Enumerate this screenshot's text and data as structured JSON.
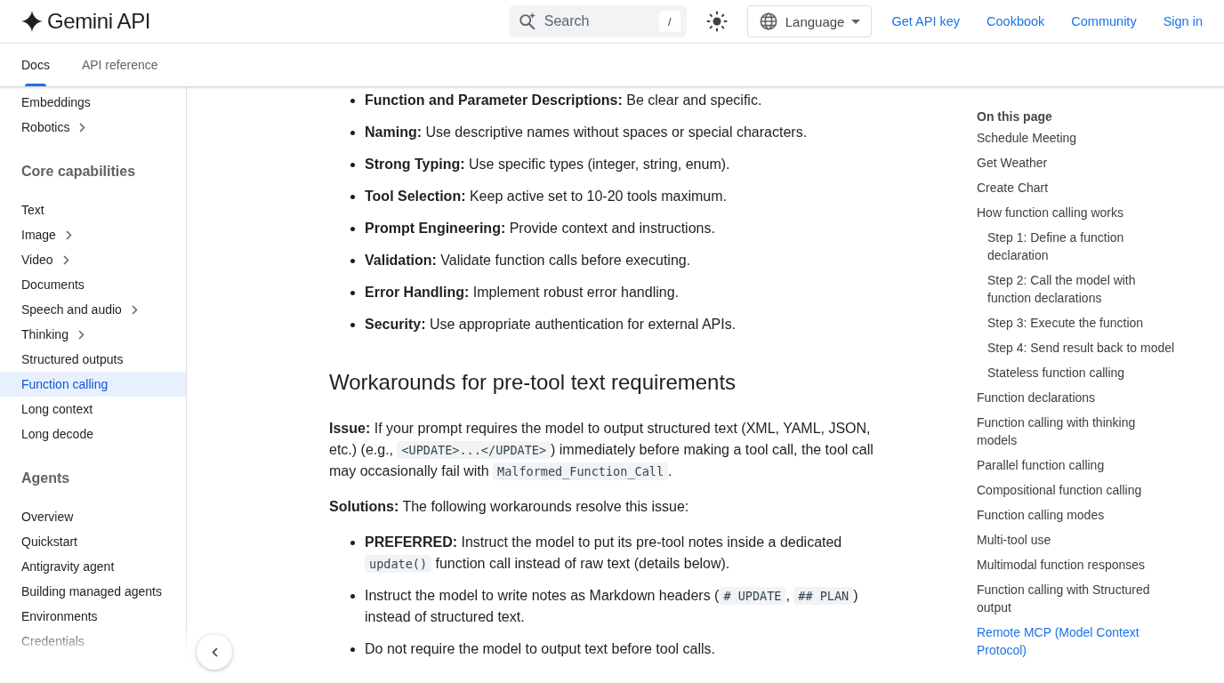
{
  "header": {
    "product_name": "Gemini API",
    "search": {
      "placeholder": "Search",
      "shortcut": "/"
    },
    "language_button": {
      "label": "Language"
    },
    "links": [
      "Get API key",
      "Cookbook",
      "Community",
      "Sign in"
    ]
  },
  "tabs": [
    {
      "label": "Docs",
      "selected": true
    },
    {
      "label": "API reference",
      "selected": false
    }
  ],
  "sidebar": {
    "groups": [
      {
        "items": [
          {
            "label": "Embeddings",
            "selected": false,
            "expandable": false
          },
          {
            "label": "Robotics",
            "selected": false,
            "expandable": true
          }
        ]
      },
      {
        "heading": "Core capabilities",
        "items": [
          {
            "label": "Text",
            "selected": false,
            "expandable": false
          },
          {
            "label": "Image",
            "selected": false,
            "expandable": true
          },
          {
            "label": "Video",
            "selected": false,
            "expandable": true
          },
          {
            "label": "Documents",
            "selected": false,
            "expandable": false
          },
          {
            "label": "Speech and audio",
            "selected": false,
            "expandable": true
          },
          {
            "label": "Thinking",
            "selected": false,
            "expandable": true
          },
          {
            "label": "Structured outputs",
            "selected": false,
            "expandable": false
          },
          {
            "label": "Function calling",
            "selected": true,
            "expandable": false
          },
          {
            "label": "Long context",
            "selected": false,
            "expandable": false
          },
          {
            "label": "Long decode",
            "selected": false,
            "expandable": false
          }
        ]
      },
      {
        "heading": "Agents",
        "items": [
          {
            "label": "Overview",
            "selected": false,
            "expandable": false
          },
          {
            "label": "Quickstart",
            "selected": false,
            "expandable": false
          },
          {
            "label": "Antigravity agent",
            "selected": false,
            "expandable": false
          },
          {
            "label": "Building managed agents",
            "selected": false,
            "expandable": false
          },
          {
            "label": "Environments",
            "selected": false,
            "expandable": false
          },
          {
            "label": "Credentials",
            "selected": false,
            "expandable": false
          }
        ]
      }
    ]
  },
  "article": {
    "blocks": [
      {
        "kind": "list",
        "items": [
          {
            "segments": [
              {
                "kind": "bold",
                "text": "Function and Parameter Descriptions:"
              },
              {
                "kind": "text",
                "text": " Be clear and specific."
              }
            ]
          },
          {
            "segments": [
              {
                "kind": "bold",
                "text": "Naming:"
              },
              {
                "kind": "text",
                "text": " Use descriptive names without spaces or special characters."
              }
            ]
          },
          {
            "segments": [
              {
                "kind": "bold",
                "text": "Strong Typing:"
              },
              {
                "kind": "text",
                "text": " Use specific types (integer, string, enum)."
              }
            ]
          },
          {
            "segments": [
              {
                "kind": "bold",
                "text": "Tool Selection:"
              },
              {
                "kind": "text",
                "text": " Keep active set to 10-20 tools maximum."
              }
            ]
          },
          {
            "segments": [
              {
                "kind": "bold",
                "text": "Prompt Engineering:"
              },
              {
                "kind": "text",
                "text": " Provide context and instructions."
              }
            ]
          },
          {
            "segments": [
              {
                "kind": "bold",
                "text": "Validation:"
              },
              {
                "kind": "text",
                "text": " Validate function calls before executing."
              }
            ]
          },
          {
            "segments": [
              {
                "kind": "bold",
                "text": "Error Handling:"
              },
              {
                "kind": "text",
                "text": " Implement robust error handling."
              }
            ]
          },
          {
            "segments": [
              {
                "kind": "bold",
                "text": "Security:"
              },
              {
                "kind": "text",
                "text": " Use appropriate authentication for external APIs."
              }
            ]
          }
        ]
      },
      {
        "kind": "heading",
        "text": "Workarounds for pre-tool text requirements"
      },
      {
        "kind": "paragraph",
        "segments": [
          {
            "kind": "bold",
            "text": "Issue:"
          },
          {
            "kind": "text",
            "text": " If your prompt requires the model to output structured text (XML, YAML, JSON, etc.) (e.g., "
          },
          {
            "kind": "code",
            "text": "<UPDATE>...</UPDATE>"
          },
          {
            "kind": "text",
            "text": ") immediately before making a tool call, the tool call may occasionally fail with "
          },
          {
            "kind": "code",
            "text": "Malformed_Function_Call"
          },
          {
            "kind": "text",
            "text": "."
          }
        ]
      },
      {
        "kind": "paragraph",
        "segments": [
          {
            "kind": "bold",
            "text": "Solutions:"
          },
          {
            "kind": "text",
            "text": " The following workarounds resolve this issue:"
          }
        ]
      },
      {
        "kind": "list",
        "items": [
          {
            "segments": [
              {
                "kind": "bold",
                "text": "PREFERRED:"
              },
              {
                "kind": "text",
                "text": " Instruct the model to put its pre-tool notes inside a dedicated "
              },
              {
                "kind": "code",
                "text": "update()"
              },
              {
                "kind": "text",
                "text": " function call instead of raw text (details below)."
              }
            ]
          },
          {
            "segments": [
              {
                "kind": "text",
                "text": "Instruct the model to write notes as Markdown headers ("
              },
              {
                "kind": "code",
                "text": "# UPDATE"
              },
              {
                "kind": "text",
                "text": ", "
              },
              {
                "kind": "code",
                "text": "## PLAN"
              },
              {
                "kind": "text",
                "text": ") instead of structured text."
              }
            ]
          },
          {
            "segments": [
              {
                "kind": "text",
                "text": "Do not require the model to output text before tool calls."
              }
            ]
          }
        ]
      }
    ]
  },
  "toc": {
    "title": "On this page",
    "items": [
      {
        "label": "Schedule Meeting",
        "selected": false
      },
      {
        "label": "Get Weather",
        "selected": false
      },
      {
        "label": "Create Chart",
        "selected": false
      },
      {
        "label": "How function calling works",
        "selected": false,
        "children": [
          {
            "label": "Step 1: Define a function declaration",
            "selected": false
          },
          {
            "label": "Step 2: Call the model with function declarations",
            "selected": false
          },
          {
            "label": "Step 3: Execute the function",
            "selected": false
          },
          {
            "label": "Step 4: Send result back to model",
            "selected": false
          },
          {
            "label": "Stateless function calling",
            "selected": false
          }
        ]
      },
      {
        "label": "Function declarations",
        "selected": false
      },
      {
        "label": "Function calling with thinking models",
        "selected": false
      },
      {
        "label": "Parallel function calling",
        "selected": false
      },
      {
        "label": "Compositional function calling",
        "selected": false
      },
      {
        "label": "Function calling modes",
        "selected": false
      },
      {
        "label": "Multi-tool use",
        "selected": false
      },
      {
        "label": "Multimodal function responses",
        "selected": false
      },
      {
        "label": "Function calling with Structured output",
        "selected": false
      },
      {
        "label": "Remote MCP (Model Context Protocol)",
        "selected": true
      }
    ]
  }
}
